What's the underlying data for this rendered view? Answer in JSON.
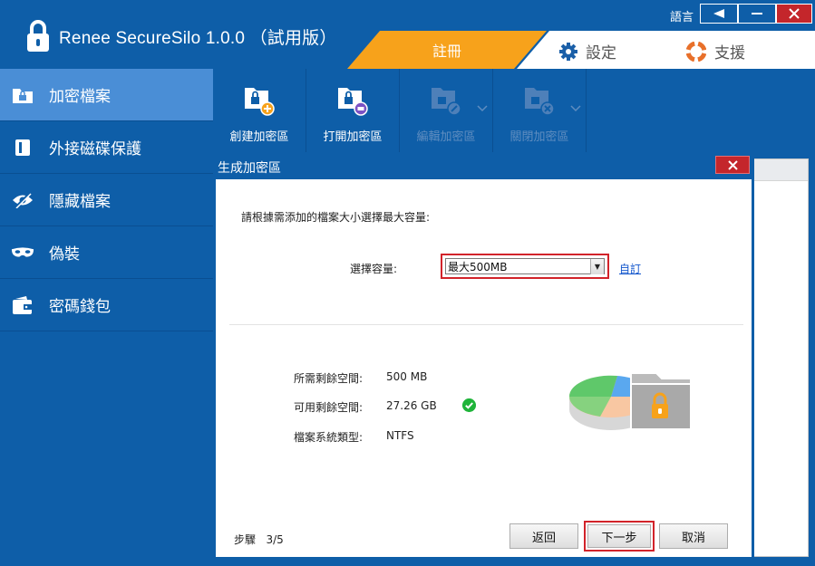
{
  "app": {
    "title": "Renee SecureSilo 1.0.0 （試用版）",
    "colors": {
      "primary": "#0e5ea8",
      "accent": "#f7a21b",
      "active": "#4a8ed6",
      "danger": "#c4262b",
      "success": "#1fb43a"
    }
  },
  "titlebar": {
    "lang_label": "語言",
    "tabs": {
      "register": "註冊",
      "settings": "設定",
      "support": "支援"
    }
  },
  "sidebar": {
    "items": [
      {
        "label": "加密檔案",
        "icon": "lock-folder-icon"
      },
      {
        "label": "外接磁碟保護",
        "icon": "usb-drive-icon"
      },
      {
        "label": "隱藏檔案",
        "icon": "eye-hidden-icon"
      },
      {
        "label": "偽裝",
        "icon": "mask-icon"
      },
      {
        "label": "密碼錢包",
        "icon": "wallet-icon"
      }
    ]
  },
  "toolbar": {
    "tools": [
      {
        "label": "創建加密區",
        "enabled": true
      },
      {
        "label": "打開加密區",
        "enabled": true
      },
      {
        "label": "編輯加密區",
        "enabled": false
      },
      {
        "label": "關閉加密區",
        "enabled": false
      }
    ]
  },
  "dialog": {
    "title": "生成加密區",
    "prompt": "請根據需添加的檔案大小選擇最大容量:",
    "capacity_label": "選擇容量:",
    "capacity_value": "最大500MB",
    "custom_link": "自訂",
    "info": {
      "required_label": "所需剩餘空間:",
      "required_value": "500 MB",
      "available_label": "可用剩餘空間:",
      "available_value": "27.26 GB",
      "fs_label": "檔案系統類型:",
      "fs_value": "NTFS"
    },
    "step_label": "步驟",
    "step_value": "3/5",
    "buttons": {
      "back": "返回",
      "next": "下一步",
      "cancel": "取消"
    }
  }
}
